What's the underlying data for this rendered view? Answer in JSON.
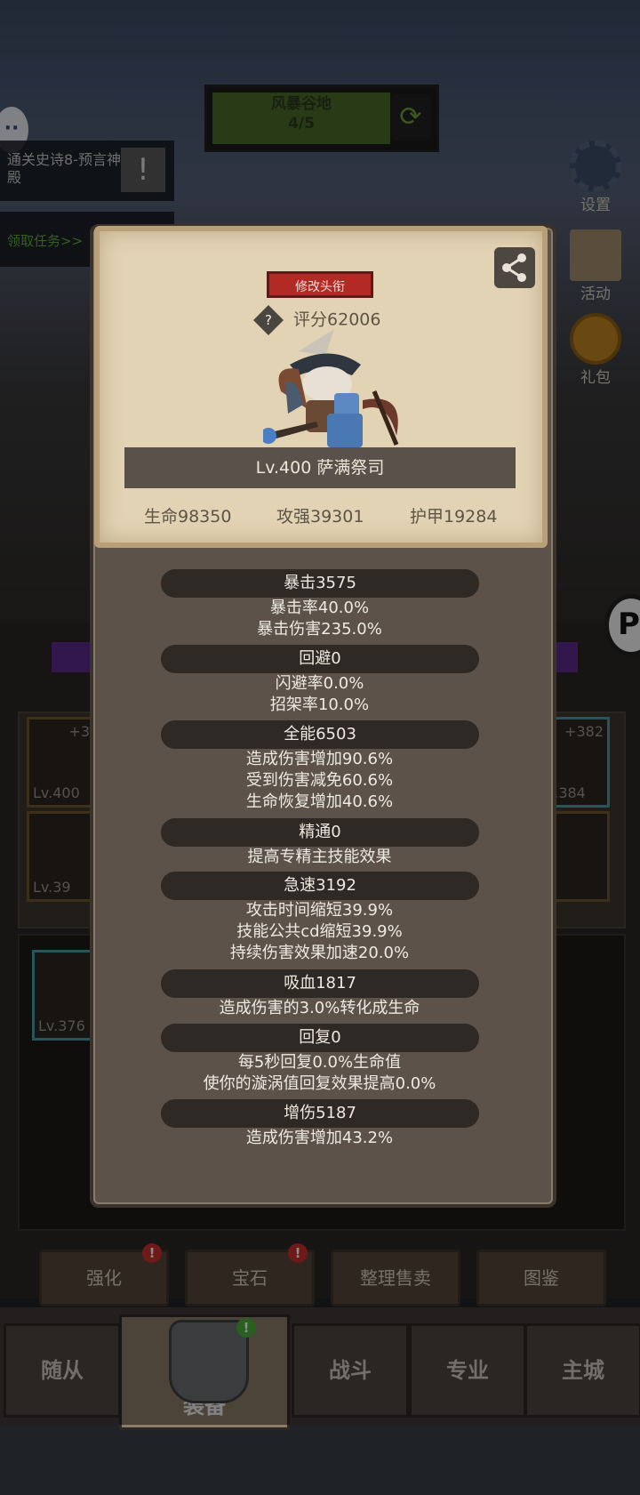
{
  "banner": {
    "title": "风暴谷地",
    "progress": "4/5"
  },
  "quest": {
    "text": "通关史诗8-预言神殿",
    "action": "领取任务>>"
  },
  "side_menu": [
    {
      "label": "设置",
      "icon": "gear-icon"
    },
    {
      "label": "活动",
      "icon": "event-icon"
    },
    {
      "label": "礼包",
      "icon": "gift-icon"
    }
  ],
  "background_cards": {
    "top_left_plus": "+3",
    "top_left_level": "Lv.400",
    "top_right_plus": "+382",
    "top_right_level": "v.384",
    "mid_left_level": "Lv.39",
    "grid_level": "Lv.376"
  },
  "card": {
    "title_button": "修改头衔",
    "score": "评分62006",
    "score_help_icon": "?",
    "name": "Lv.400 萨满祭司",
    "hp": "生命98350",
    "attack": "攻强39301",
    "armor": "护甲19284"
  },
  "stats": [
    {
      "header": "暴击3575",
      "lines": [
        "暴击率40.0%",
        "暴击伤害235.0%"
      ]
    },
    {
      "header": "回避0",
      "lines": [
        "闪避率0.0%",
        "招架率10.0%"
      ]
    },
    {
      "header": "全能6503",
      "lines": [
        "造成伤害增加90.6%",
        "受到伤害减免60.6%",
        "生命恢复增加40.6%"
      ]
    },
    {
      "header": "精通0",
      "lines": [
        "提高专精主技能效果"
      ]
    },
    {
      "header": "急速3192",
      "lines": [
        "攻击时间缩短39.9%",
        "技能公共cd缩短39.9%",
        "持续伤害效果加速20.0%"
      ]
    },
    {
      "header": "吸血1817",
      "lines": [
        "造成伤害的3.0%转化成生命"
      ]
    },
    {
      "header": "回复0",
      "lines": [
        "每5秒回复0.0%生命值",
        "使你的漩涡值回复效果提高0.0%"
      ]
    },
    {
      "header": "增伤5187",
      "lines": [
        "造成伤害增加43.2%"
      ]
    }
  ],
  "action_buttons": [
    "强化",
    "宝石",
    "整理售卖",
    "图鉴"
  ],
  "bottom_nav": [
    "随从",
    "装备",
    "战斗",
    "专业",
    "主城"
  ],
  "badge": "!",
  "float_button": "P"
}
